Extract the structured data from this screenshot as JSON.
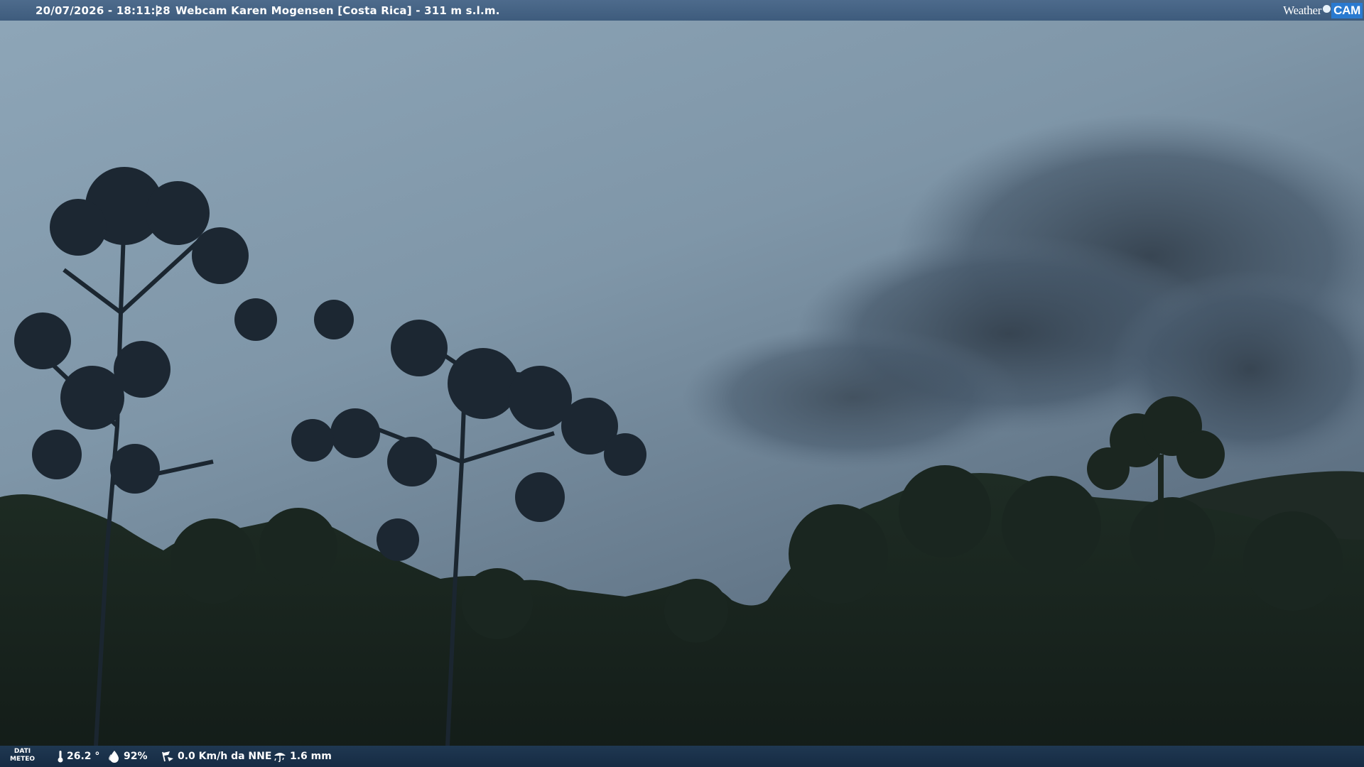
{
  "header": {
    "datetime": "20/07/2026 - 18:11:28",
    "separator": "|",
    "title": "Webcam Karen Mogensen [Costa Rica]  - 311 m s.l.m."
  },
  "brand": {
    "word": "Weather",
    "cam": "CAM"
  },
  "weather": {
    "label_line1": "DATI",
    "label_line2": "METEO",
    "temperature": "26.2 °",
    "humidity": "92%",
    "wind": "0.0 Km/h da NNE",
    "rain": "1.6 mm"
  },
  "icons": {
    "temperature": "thermometer-icon",
    "humidity": "humidity-drop-icon",
    "wind": "wind-icon",
    "rain": "rain-icon"
  },
  "colors": {
    "topbar": "#4a688a",
    "bottombar": "#203a56",
    "cam_badge": "#2a7ad0"
  }
}
